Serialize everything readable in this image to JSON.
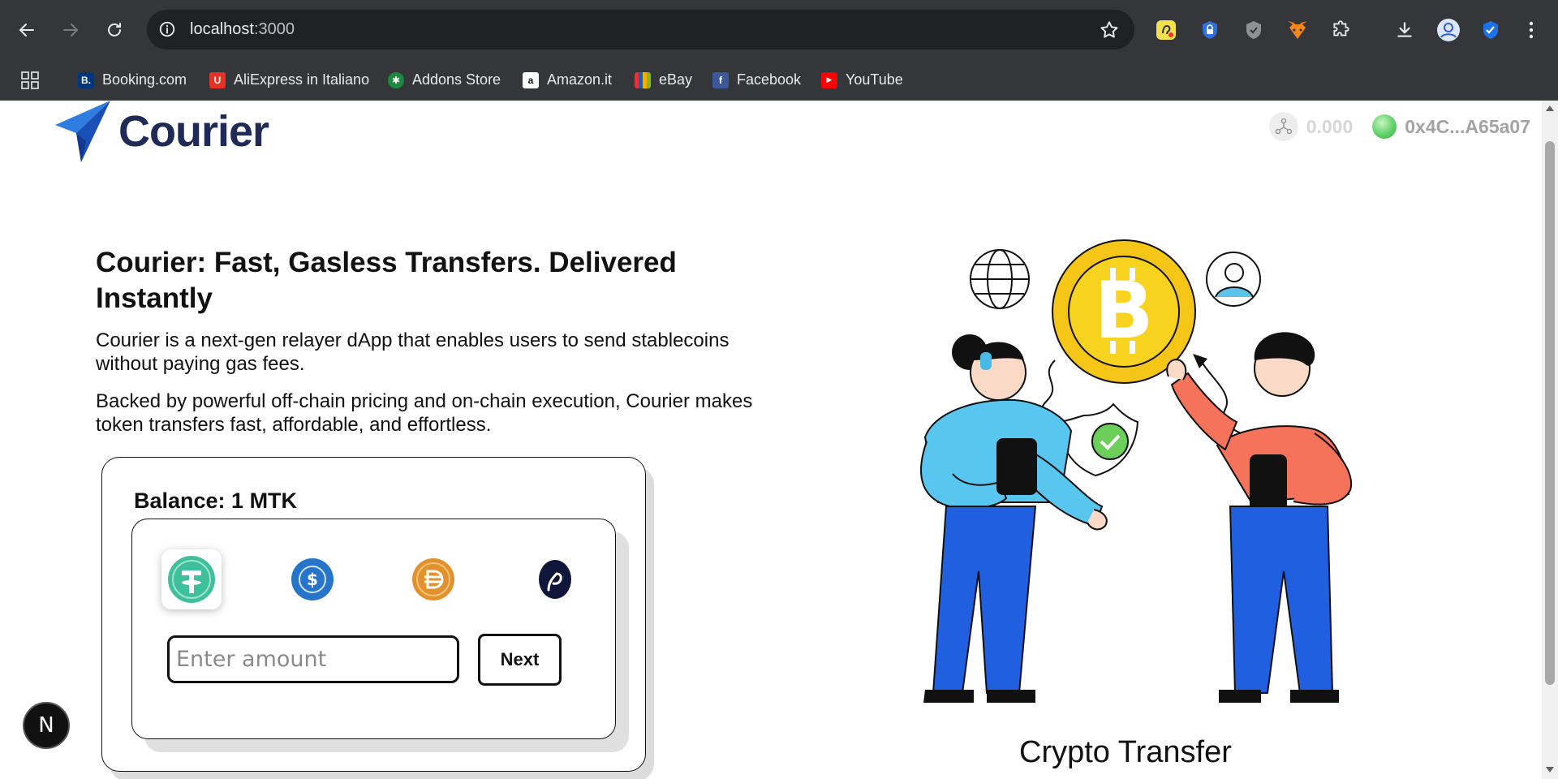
{
  "browser": {
    "url_host": "localhost",
    "url_port": ":3000",
    "bookmarks": [
      {
        "label": "Booking.com",
        "icon": "booking-icon",
        "color": "#003580",
        "glyph": "B."
      },
      {
        "label": "AliExpress in Italiano",
        "icon": "aliexpress-icon",
        "color": "#e43225",
        "glyph": "U"
      },
      {
        "label": "Addons Store",
        "icon": "addons-icon",
        "color": "#1b8a3e",
        "glyph": "✱"
      },
      {
        "label": "Amazon.it",
        "icon": "amazon-icon",
        "color": "#ffffff",
        "glyph": "a"
      },
      {
        "label": "eBay",
        "icon": "ebay-icon",
        "color": "#e53238",
        "glyph": "e"
      },
      {
        "label": "Facebook",
        "icon": "facebook-icon",
        "color": "#1877f2",
        "glyph": "f"
      },
      {
        "label": "YouTube",
        "icon": "youtube-icon",
        "color": "#ff0000",
        "glyph": "▶"
      }
    ]
  },
  "header": {
    "brand": "Courier",
    "gas_balance": "0.000",
    "wallet_address": "0x4C...A65a07"
  },
  "hero": {
    "title": "Courier: Fast, Gasless Transfers. Delivered Instantly",
    "paragraph1": "Courier is a next-gen relayer dApp that enables users to send stablecoins without paying gas fees.",
    "paragraph2": "Backed by powerful off-chain pricing and on-chain execution, Courier makes token transfers fast, affordable, and effortless."
  },
  "transfer": {
    "balance": "Balance: 1 MTK",
    "amount_placeholder": "Enter amount",
    "next_label": "Next",
    "tokens": [
      "usdt-icon",
      "usdc-icon",
      "dai-icon",
      "pyusd-icon"
    ]
  },
  "illustration": {
    "caption": "Crypto Transfer"
  },
  "nextjs_badge": "N"
}
